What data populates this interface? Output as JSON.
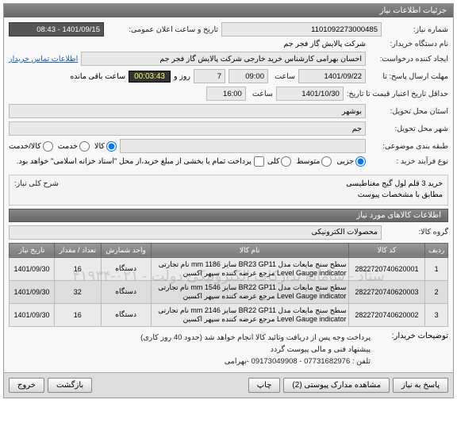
{
  "panel_title": "جزئیات اطلاعات نیاز",
  "labels": {
    "reqno": "شماره نیاز:",
    "pubdate": "تاریخ و ساعت اعلان عمومی:",
    "buyer": "نام دستگاه خریدار:",
    "creator": "ایجاد کننده درخواست:",
    "contact": "اطلاعات تماس خریدار",
    "deadline": "مهلت ارسال پاسخ: تا",
    "time1": "ساعت",
    "daysep": "روز و",
    "remain": "ساعت باقی مانده",
    "validity": "حداقل تاریخ اعتبار قیمت تا تاریخ:",
    "time2": "ساعت",
    "province": "استان محل تحویل:",
    "city": "شهر محل تحویل:",
    "category": "طبقه بندی موضوعی:",
    "buytype": "نوع فرآیند خرید :",
    "paynote": "پرداخت تمام یا بخشی از مبلغ خرید،از محل \"اسناد خزانه اسلامی\" خواهد بود.",
    "desc_title": "شرح کلی نیاز:",
    "section_items": "اطلاعات کالاهای مورد نیاز",
    "goods_group": "گروه کالا:",
    "notes_title": "توضیحات خریدار:"
  },
  "values": {
    "reqno": "1101092273000485",
    "pubdate": "1401/09/15 - 08:43",
    "buyer": "شرکت پالایش گاز فجر جم",
    "creator": "احسان بهرامی کارشناس خرید خارجی شرکت پالایش گاز فجر جم",
    "deadline_date": "1401/09/22",
    "deadline_time": "09:00",
    "days": "7",
    "timer": "00:03:43",
    "validity_date": "1401/10/30",
    "validity_time": "16:00",
    "province": "بوشهر",
    "city": "جم",
    "category": "",
    "goods_group": "محصولات الکترونیکی"
  },
  "radios": {
    "buytype": [
      "جزیی",
      "متوسط",
      "کلی"
    ],
    "ksr": [
      "کالا",
      "خدمت",
      "کالا/خدمت"
    ]
  },
  "desc_lines": [
    "خرید 3 قلم لول گیج مغناطیسی",
    "مطابق با مشخصات پیوست"
  ],
  "watermark": "ستاد - سامانه تدارکات الکترونیکی دولت - ۰۲۱-۴۱۹۳۴",
  "columns": [
    "ردیف",
    "کد کالا",
    "نام کالا",
    "واحد شمارش",
    "تعداد / مقدار",
    "تاریخ نیاز"
  ],
  "rows": [
    {
      "n": "1",
      "code": "2822720740620001",
      "name": "سطح سنج مایعات مدل BR23 GP11 سایز 1186 mm نام تجارتی Level Gauge indicator مرجع عرضه کننده سپهر اکسین",
      "unit": "دستگاه",
      "qty": "16",
      "date": "1401/09/30"
    },
    {
      "n": "2",
      "code": "2822720740620003",
      "name": "سطح سنج مایعات مدل BR22 GP11 سایز 1546 mm نام تجارتی Level Gauge indicator مرجع عرضه کننده سپهر اکسین",
      "unit": "دستگاه",
      "qty": "32",
      "date": "1401/09/30"
    },
    {
      "n": "3",
      "code": "2822720740620002",
      "name": "سطح سنج مایعات مدل BR22 GP11 سایز 2146 mm نام تجارتی Level Gauge indicator مرجع عرضه کننده سپهر اکسین",
      "unit": "دستگاه",
      "qty": "16",
      "date": "1401/09/30"
    }
  ],
  "notes": [
    "پرداخت وجه پس از دریافت وتائید کالا انجام خواهد شد (حدود 40 روز کاری)",
    "پیشنهاد فنی و مالی پیوست گردد",
    "تلفن : 07731682976 - 09173049908 -بهرامی"
  ],
  "buttons": {
    "reply": "پاسخ به نیاز",
    "docs": "مشاهده مدارک پیوستی (2)",
    "print": "چاپ",
    "back": "بازگشت",
    "exit": "خروج"
  }
}
